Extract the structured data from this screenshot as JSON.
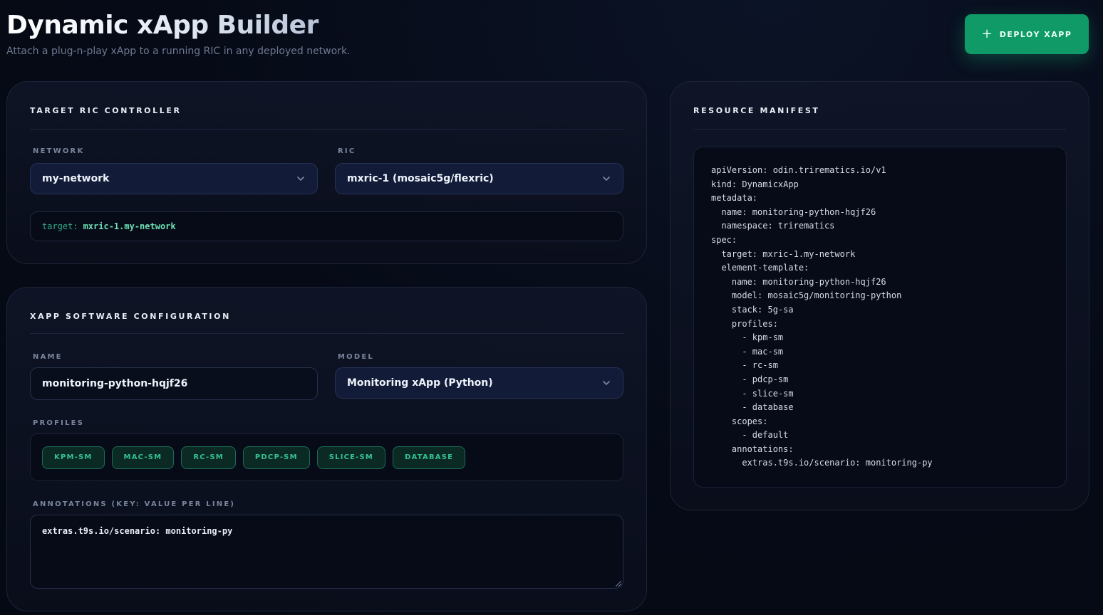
{
  "header": {
    "title": "Dynamic xApp Builder",
    "subtitle": "Attach a plug-n-play xApp to a running RIC in any deployed network."
  },
  "deploy_button": {
    "icon": "plus-icon",
    "label": "DEPLOY XAPP"
  },
  "target_card": {
    "title": "TARGET RIC CONTROLLER",
    "network_label": "NETWORK",
    "network_value": "my-network",
    "ric_label": "RIC",
    "ric_value": "mxric-1 (mosaic5g/flexric)",
    "target_key": "target:",
    "target_value": "mxric-1.my-network"
  },
  "config_card": {
    "title": "XAPP SOFTWARE CONFIGURATION",
    "name_label": "NAME",
    "name_value": "monitoring-python-hqjf26",
    "model_label": "MODEL",
    "model_value": "Monitoring xApp (Python)",
    "profiles_label": "PROFILES",
    "profiles": [
      "KPM-SM",
      "MAC-SM",
      "RC-SM",
      "PDCP-SM",
      "SLICE-SM",
      "DATABASE"
    ],
    "annotations_label": "ANNOTATIONS (KEY: VALUE PER LINE)",
    "annotations_value": "extras.t9s.io/scenario: monitoring-py"
  },
  "manifest_card": {
    "title": "RESOURCE MANIFEST",
    "lines": [
      "apiVersion: odin.trirematics.io/v1",
      "kind: DynamicxApp",
      "metadata:",
      "  name: monitoring-python-hqjf26",
      "  namespace: trirematics",
      "spec:",
      "  target: mxric-1.my-network",
      "  element-template:",
      "    name: monitoring-python-hqjf26",
      "    model: mosaic5g/monitoring-python",
      "    stack: 5g-sa",
      "    profiles:",
      "      - kpm-sm",
      "      - mac-sm",
      "      - rc-sm",
      "      - pdcp-sm",
      "      - slice-sm",
      "      - database",
      "    scopes:",
      "      - default",
      "    annotations:",
      "      extras.t9s.io/scenario: monitoring-py"
    ]
  },
  "colors": {
    "accent": "#0f9a68",
    "chip_text": "#35c08f",
    "background": "#060a16"
  }
}
